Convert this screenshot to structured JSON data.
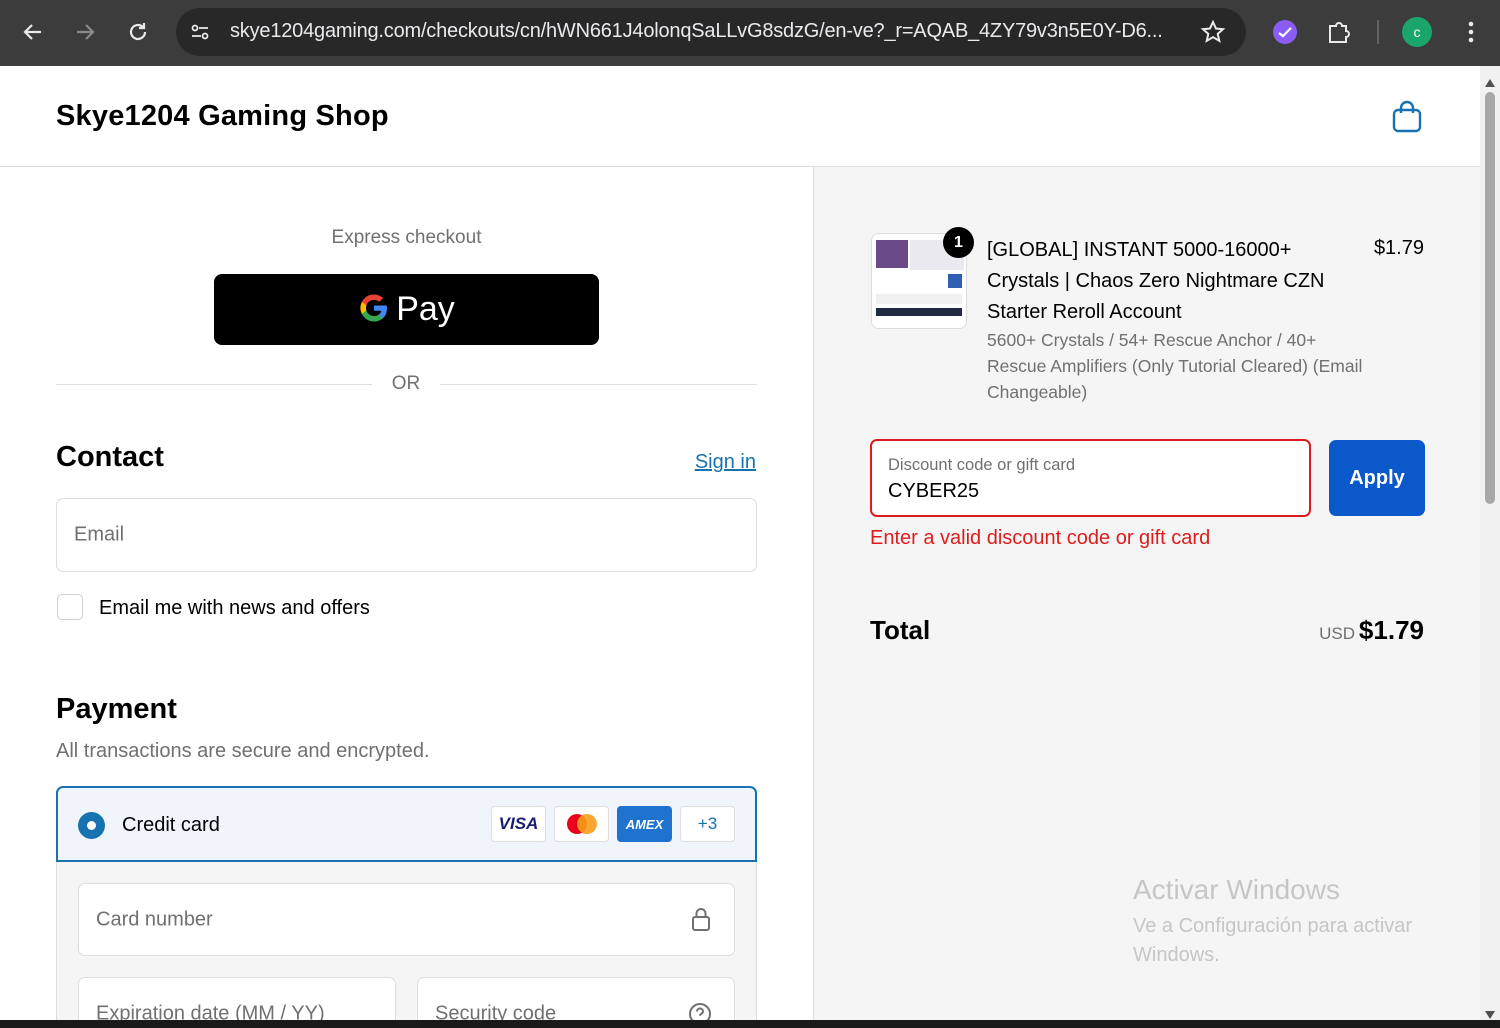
{
  "browser": {
    "url": "skye1204gaming.com/checkouts/cn/hWN661J4olonqSaLLvG8sdzG/en-ve?_r=AQAB_4ZY79v3n5E0Y-D6...",
    "profile_initial": "c"
  },
  "header": {
    "shop_name": "Skye1204 Gaming Shop"
  },
  "express": {
    "label": "Express checkout",
    "gpay_text": "Pay",
    "or": "OR"
  },
  "contact": {
    "heading": "Contact",
    "sign_in": "Sign in",
    "email_placeholder": "Email",
    "newsletter_label": "Email me with news and offers"
  },
  "payment": {
    "heading": "Payment",
    "subtitle": "All transactions are secure and encrypted.",
    "method_label": "Credit card",
    "card_brands": [
      "VISA",
      "AMEX"
    ],
    "more_cards": "+3",
    "card_number_placeholder": "Card number",
    "expiration_placeholder": "Expiration date (MM / YY)",
    "security_placeholder": "Security code"
  },
  "summary": {
    "quantity": "1",
    "product_title": "[GLOBAL] INSTANT 5000-16000+ Crystals | Chaos Zero Nightmare CZN Starter Reroll Account",
    "product_variant": "5600+ Crystals / 54+ Rescue Anchor / 40+ Rescue Amplifiers (Only Tutorial Cleared) (Email Changeable)",
    "product_price": "$1.79",
    "discount_label": "Discount code or gift card",
    "discount_value": "CYBER25",
    "apply_label": "Apply",
    "error_message": "Enter a valid discount code or gift card",
    "total_label": "Total",
    "currency": "USD",
    "total_amount": "$1.79"
  },
  "watermark": {
    "title": "Activar Windows",
    "subtitle": "Ve a Configuración para activar Windows."
  },
  "colors": {
    "accent": "#1773b0",
    "apply_button": "#0a58ca",
    "error": "#dd1d1d"
  },
  "icons": [
    "back-icon",
    "forward-icon",
    "reload-icon",
    "site-info-icon",
    "star-icon",
    "extension-icon",
    "puzzle-icon",
    "menu-icon",
    "cart-icon",
    "google-g-icon",
    "mastercard-icon",
    "lock-icon",
    "help-icon"
  ]
}
